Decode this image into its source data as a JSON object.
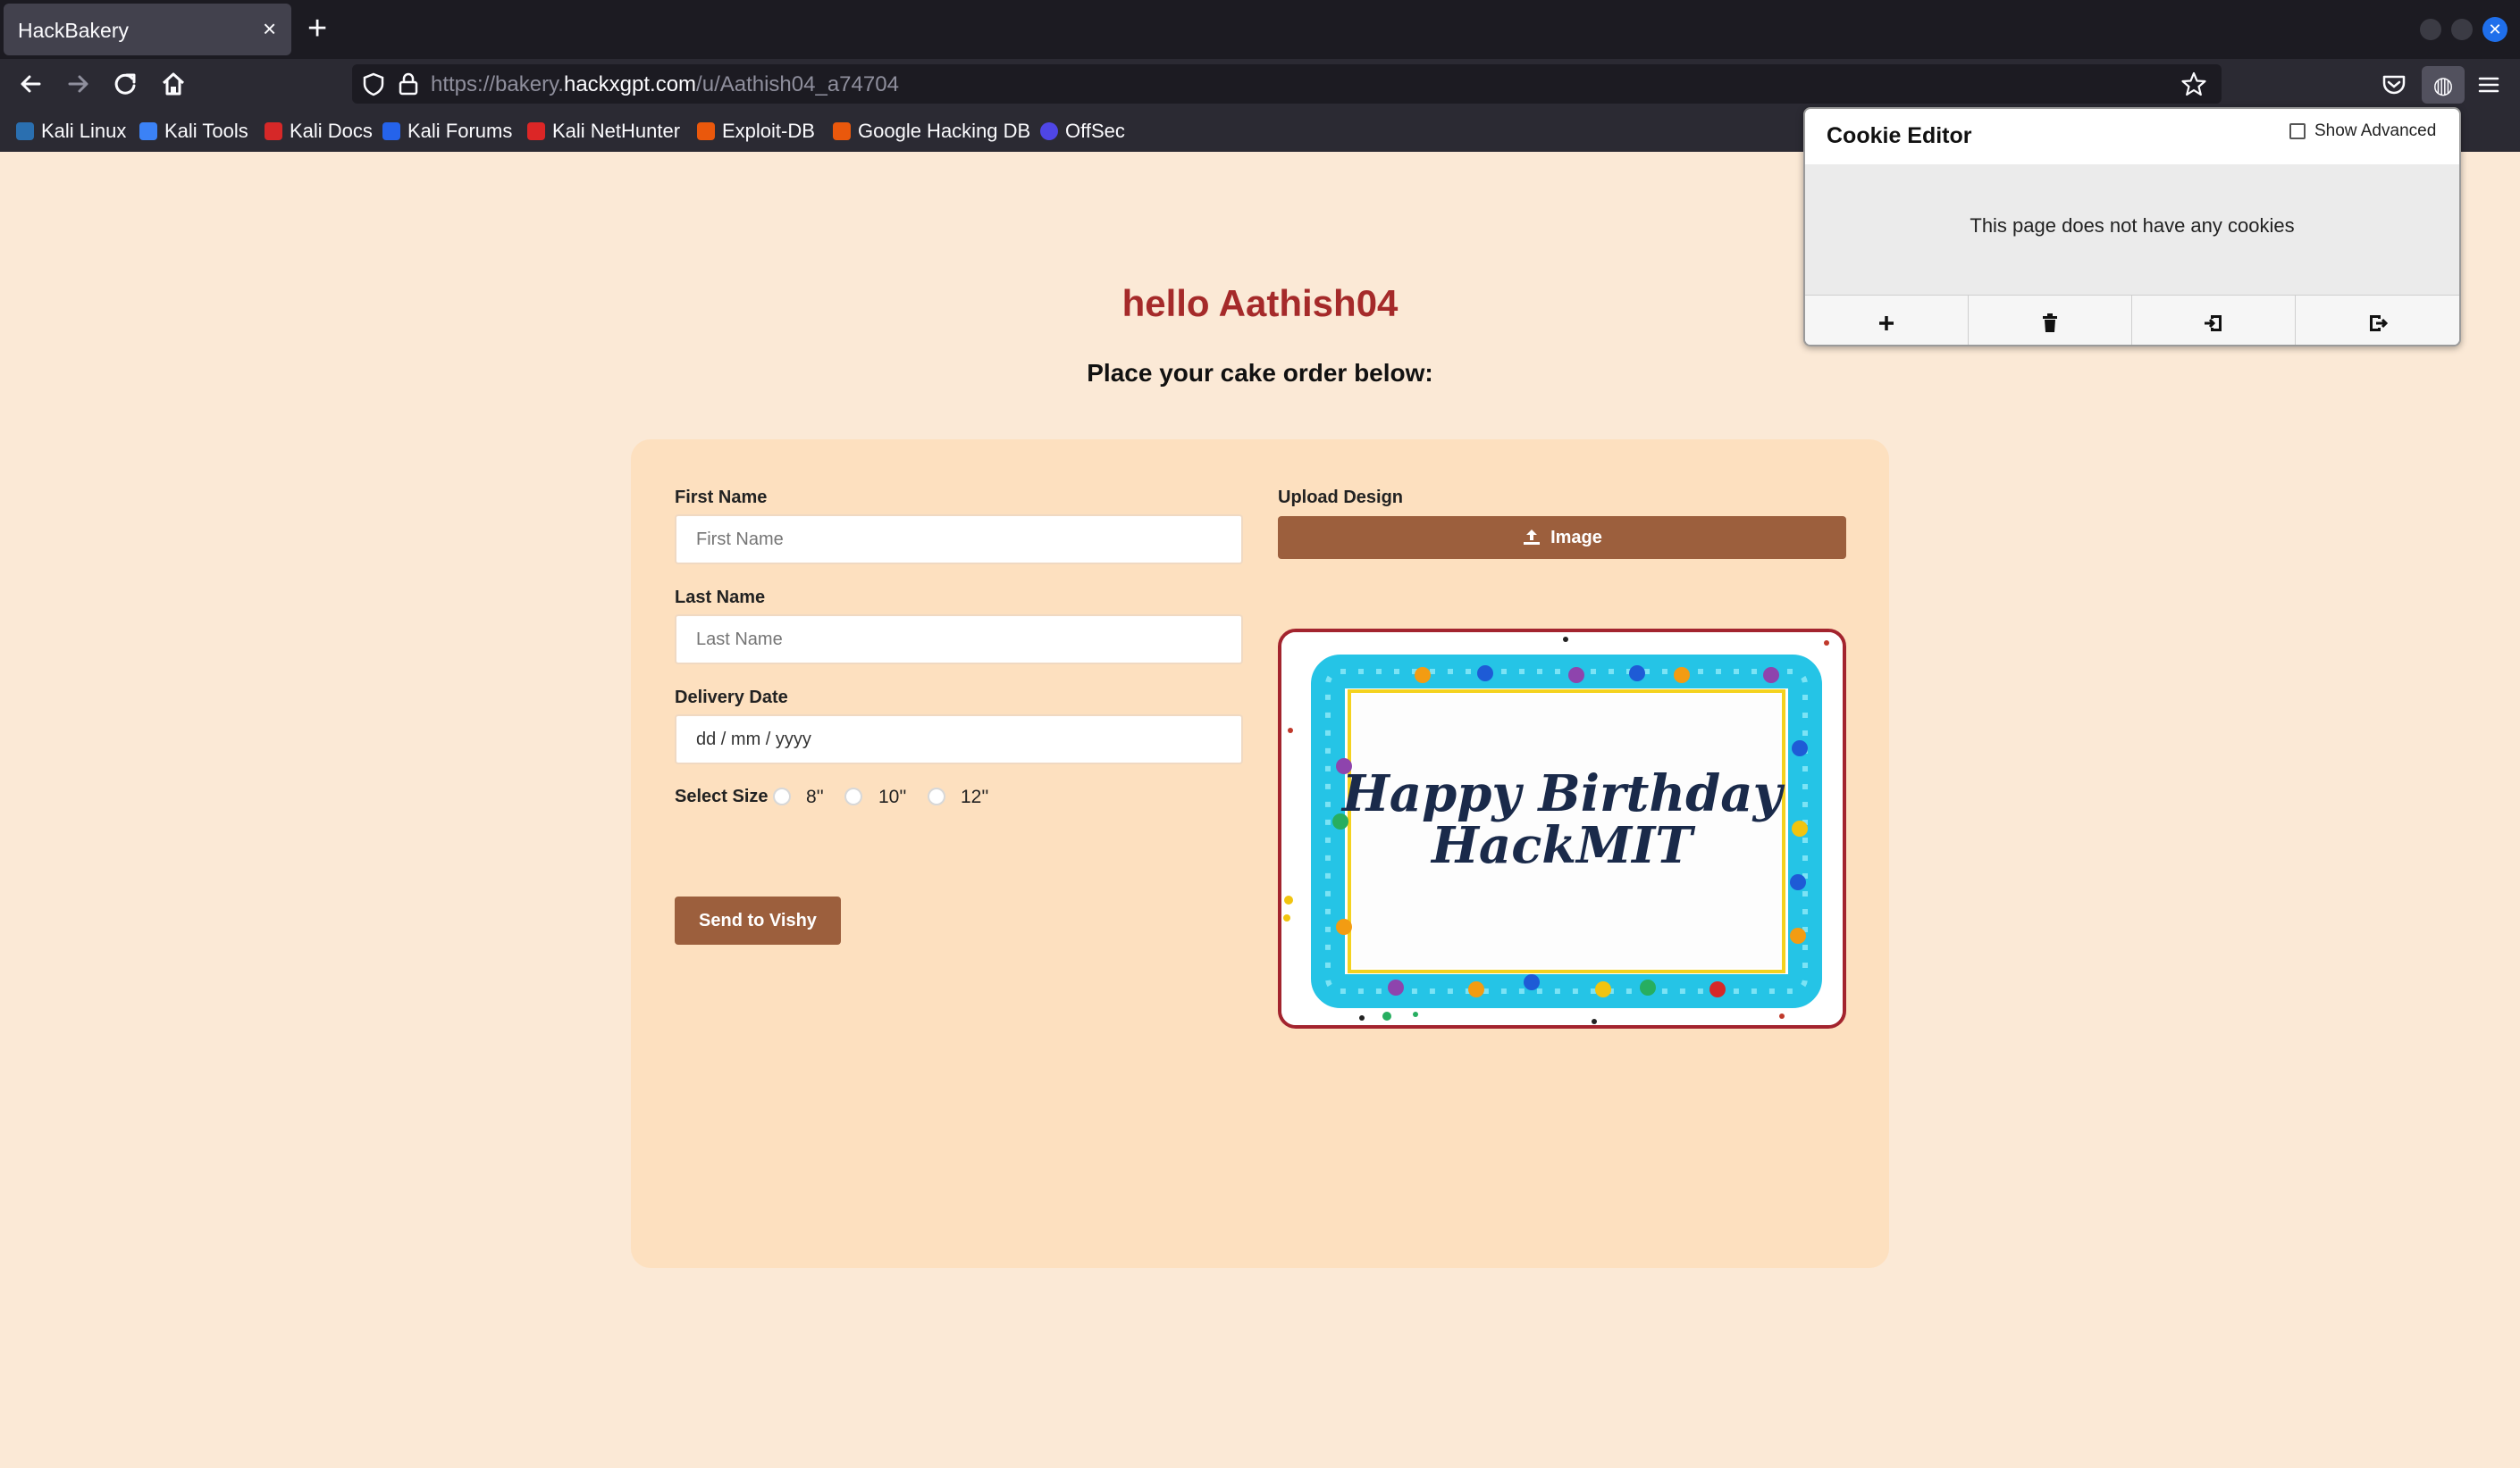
{
  "browser": {
    "tab_title": "HackBakery",
    "tab_close": "×",
    "new_tab": "+",
    "url_prefix": "https://bakery.",
    "url_host": "hackxgpt.com",
    "url_path": "/u/Aathish04_a74704",
    "bookmarks": [
      "Kali Linux",
      "Kali Tools",
      "Kali Docs",
      "Kali Forums",
      "Kali NetHunter",
      "Exploit-DB",
      "Google Hacking DB",
      "OffSec"
    ]
  },
  "page": {
    "greeting": "hello Aathish04",
    "subheading": "Place your cake order below:",
    "form": {
      "first_name_label": "First Name",
      "first_name_placeholder": "First Name",
      "last_name_label": "Last Name",
      "last_name_placeholder": "Last Name",
      "delivery_date_label": "Delivery Date",
      "delivery_date_value": "dd / mm / yyyy",
      "size_label": "Select Size",
      "sizes": [
        "8''",
        "10''",
        "12''"
      ],
      "submit_label": "Send to Vishy",
      "upload_label": "Upload Design",
      "upload_button_label": "Image"
    },
    "cake_text_line1": "Happy Birthday",
    "cake_text_line2": "HackMIT"
  },
  "cookie_editor": {
    "title": "Cookie Editor",
    "show_advanced_label": "Show Advanced",
    "message": "This page does not have any cookies",
    "actions": [
      "add-icon",
      "delete-icon",
      "import-icon",
      "export-icon"
    ]
  },
  "colors": {
    "page_bg": "#fbe9d6",
    "card_bg": "#fde0bf",
    "button_brown": "#9c5f3d",
    "greeting_red": "#a52a2a",
    "frame_red": "#a3242e",
    "frosting_blue": "#25c4e6"
  }
}
